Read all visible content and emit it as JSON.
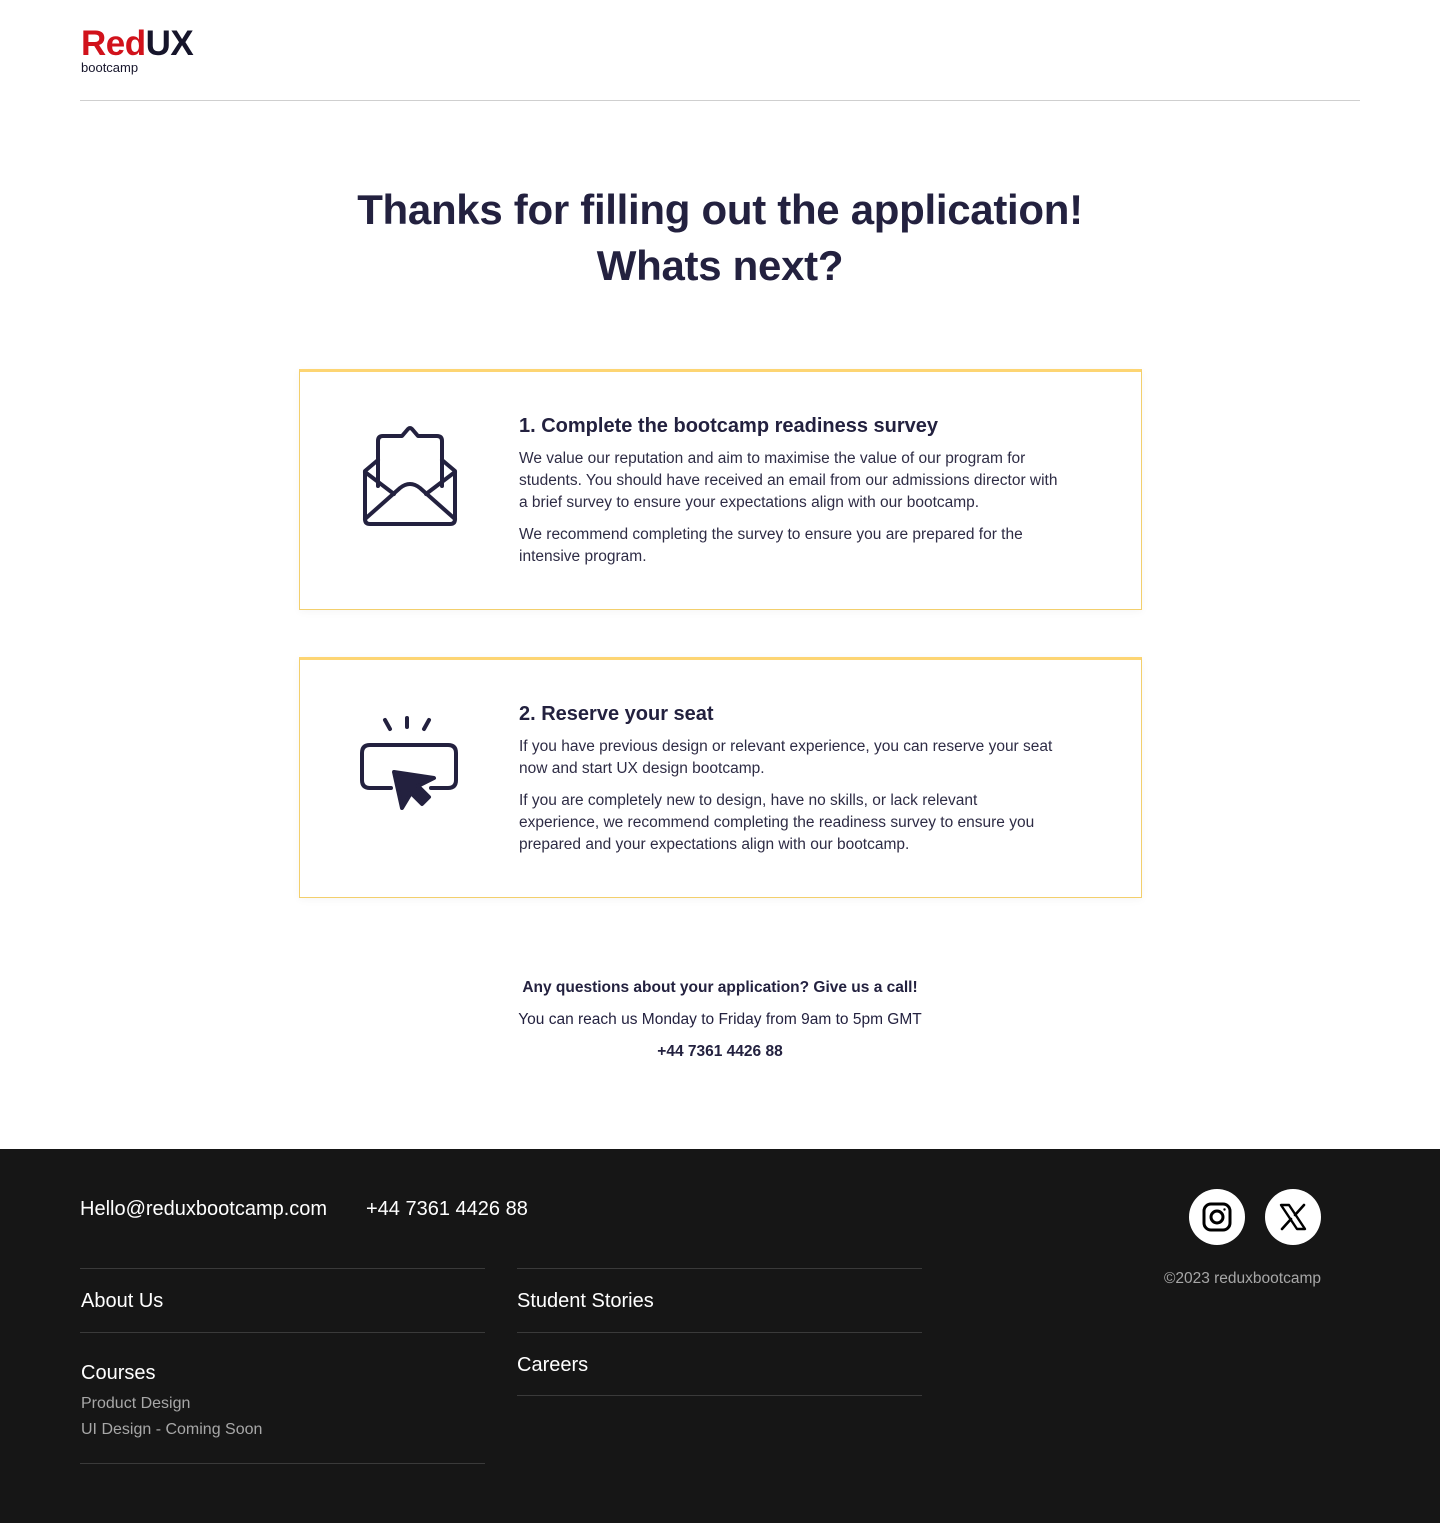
{
  "brand": {
    "name_red": "Red",
    "name_dark": "UX",
    "subtitle": "bootcamp",
    "colors": {
      "red": "#d1121b",
      "dark": "#16152b",
      "card_border": "#fdd573",
      "footer_bg": "#161616"
    }
  },
  "heading": {
    "line1": "Thanks for filling out the application!",
    "line2": "Whats next?"
  },
  "steps": [
    {
      "icon": "envelope-open-icon",
      "title": "1. Complete the bootcamp readiness survey",
      "paragraph1": "We value our reputation and aim to maximise the value of our program for students. You should have received an email from our admissions director with a brief survey to ensure your expectations align with our bootcamp.",
      "paragraph2": "We recommend completing the survey to ensure you are prepared for the intensive program."
    },
    {
      "icon": "click-button-icon",
      "title": "2. Reserve your seat",
      "paragraph1": "If you have previous design or relevant experience, you can reserve your seat now and start UX design bootcamp.",
      "paragraph2": "If you are completely new to design, have no skills, or lack relevant experience, we recommend completing the readiness survey to ensure you prepared and your expectations align with our bootcamp."
    }
  ],
  "contact": {
    "question": "Any questions about your application? Give us a call!",
    "hours": "You can reach us Monday to Friday from 9am to 5pm GMT",
    "phone": "+44 7361 4426 88"
  },
  "footer": {
    "email": "Hello@reduxbootcamp.com",
    "phone": "+44 7361 4426 88",
    "social": [
      "instagram-icon",
      "x-icon"
    ],
    "copyright": "©2023 reduxbootcamp",
    "col1": {
      "about": "About Us",
      "courses": "Courses",
      "course_items": [
        "Product Design",
        "UI Design - Coming Soon"
      ]
    },
    "col2": {
      "stories": "Student Stories",
      "careers": "Careers"
    }
  }
}
